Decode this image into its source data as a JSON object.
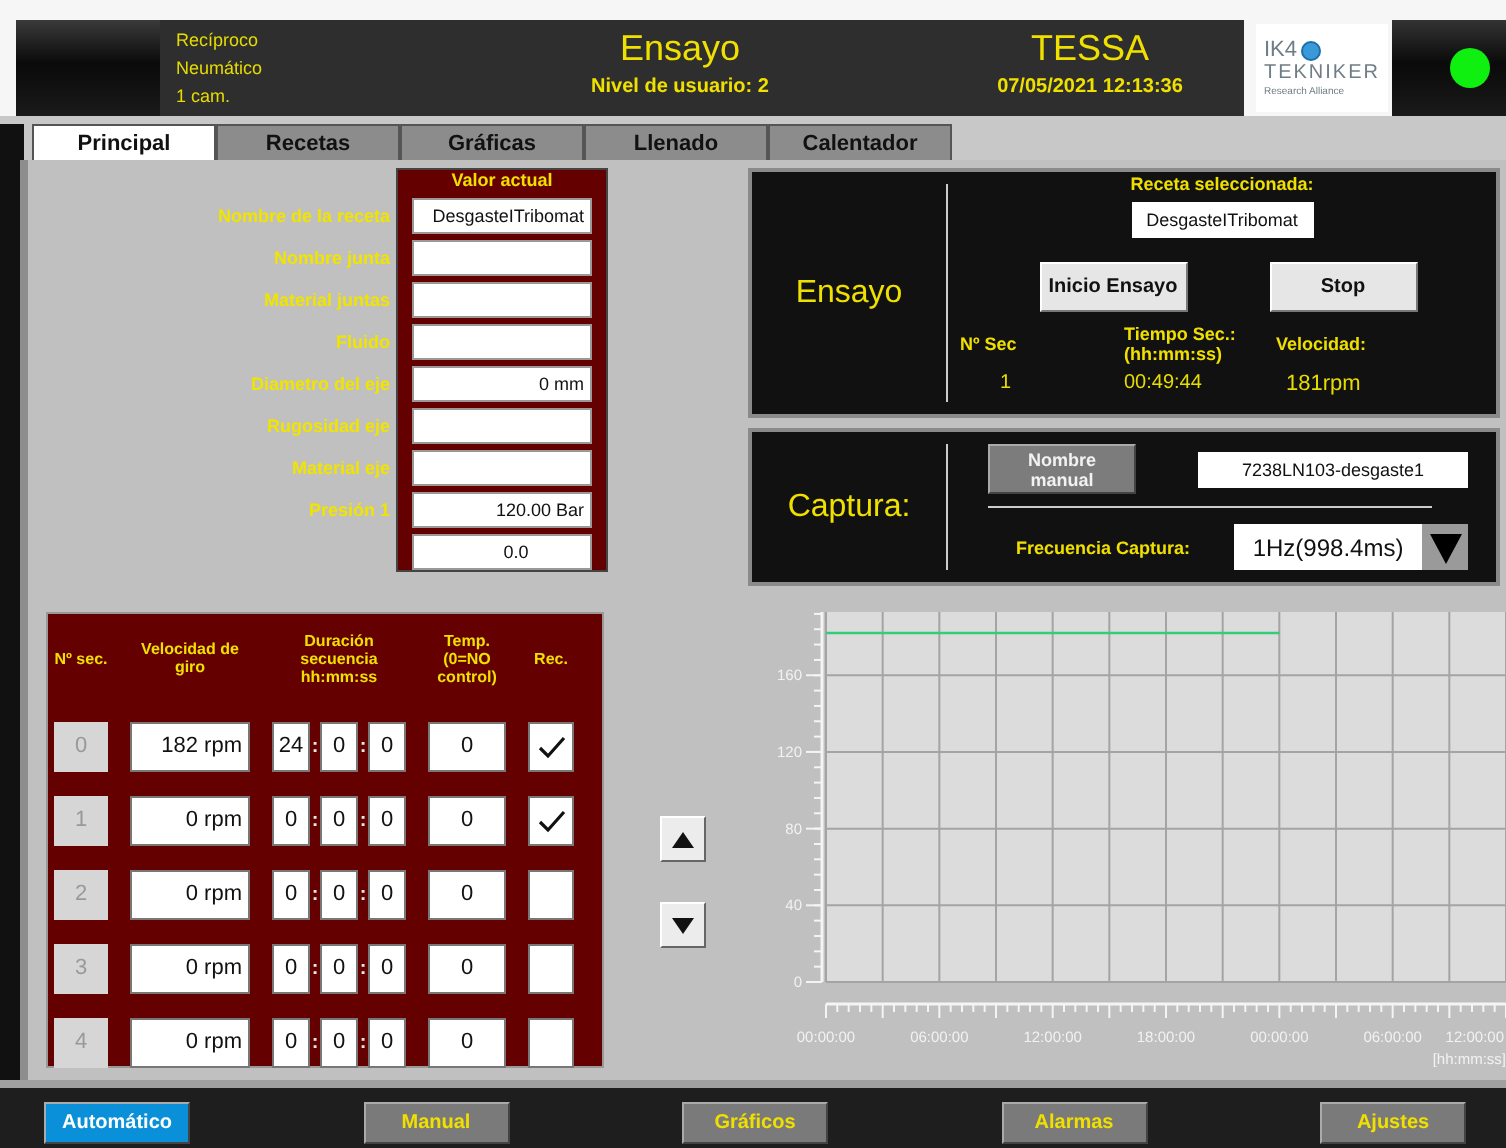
{
  "header": {
    "info_lines": [
      "Recíproco",
      "Neumático",
      "1 cam."
    ],
    "title": "Ensayo",
    "user_level": "Nivel de usuario: 2",
    "app_name": "TESSA",
    "datetime": "07/05/2021 12:13:36",
    "logo": {
      "line1": "IK4",
      "line2": "TEKNIKER",
      "tagline": "Research Alliance"
    },
    "status_on": true
  },
  "tabs": [
    {
      "label": "Principal",
      "selected": true
    },
    {
      "label": "Recetas",
      "selected": false
    },
    {
      "label": "Gráficas",
      "selected": false
    },
    {
      "label": "Llenado",
      "selected": false
    },
    {
      "label": "Calentador",
      "selected": false
    }
  ],
  "recipe": {
    "heading": "Valor actual",
    "fields": [
      {
        "label": "Nombre de la receta",
        "value": "DesgasteITribomat"
      },
      {
        "label": "Nombre junta"
      },
      {
        "label": "Material juntas"
      },
      {
        "label": "Fluido"
      },
      {
        "label": "Diametro del eje",
        "value": "0 mm"
      },
      {
        "label": "Rugosidad eje"
      },
      {
        "label": "Material eje"
      },
      {
        "label": "Presión 1",
        "value": "120.00  Bar"
      }
    ],
    "extra_value": "0.0"
  },
  "test_panel": {
    "title": "Ensayo",
    "recipe_label": "Receta seleccionada:",
    "recipe_value": "DesgasteITribomat",
    "buttons": [
      "Inicio Ensayo",
      "Stop"
    ],
    "stats": [
      {
        "label": "Nº Sec",
        "value": "1"
      },
      {
        "label": "Tiempo Sec.: (hh:mm:ss)",
        "value": "00:49:44"
      },
      {
        "label": "Velocidad:",
        "value": "181rpm"
      }
    ]
  },
  "capture_panel": {
    "title": "Captura:",
    "manual_button": "Nombre manual",
    "filename": "7238LN103-desgaste1",
    "frequency_label": "Frecuencia Captura:",
    "frequency_value": "1Hz(998.4ms)"
  },
  "sequence_table": {
    "columns": [
      "Nº sec.",
      "Velocidad de giro",
      "Duración secuencia hh:mm:ss",
      "Temp. (0=NO control)",
      "Rec."
    ],
    "separator": ":",
    "rows": [
      {
        "index": "0",
        "speed": "182 rpm",
        "hh": "24",
        "mm": "0",
        "ss": "0",
        "temp": "0",
        "rec": true
      },
      {
        "index": "1",
        "speed": "0 rpm",
        "hh": "0",
        "mm": "0",
        "ss": "0",
        "temp": "0",
        "rec": true
      },
      {
        "index": "2",
        "speed": "0 rpm",
        "hh": "0",
        "mm": "0",
        "ss": "0",
        "temp": "0",
        "rec": false
      },
      {
        "index": "3",
        "speed": "0 rpm",
        "hh": "0",
        "mm": "0",
        "ss": "0",
        "temp": "0",
        "rec": false
      },
      {
        "index": "4",
        "speed": "0 rpm",
        "hh": "0",
        "mm": "0",
        "ss": "0",
        "temp": "0",
        "rec": false
      }
    ]
  },
  "chart": {
    "chart_data": {
      "type": "line",
      "xlabel": "[hh:mm:ss]",
      "categories": [
        "00:00:00",
        "06:00:00",
        "12:00:00",
        "18:00:00",
        "00:00:00",
        "06:00:00",
        "12:00:00"
      ],
      "series": [
        {
          "color": "#33cc77",
          "values": [
            182,
            182,
            182,
            182,
            182,
            null,
            null
          ]
        }
      ],
      "ylim": [
        0,
        193
      ],
      "yticks": [
        0,
        40,
        80,
        120,
        160
      ],
      "grid": true
    }
  },
  "bottom_nav": [
    {
      "label": "Automático",
      "selected": true
    },
    {
      "label": "Manual",
      "selected": false
    },
    {
      "label": "Gráficos",
      "selected": false
    },
    {
      "label": "Alarmas",
      "selected": false
    },
    {
      "label": "Ajustes",
      "selected": false
    }
  ]
}
